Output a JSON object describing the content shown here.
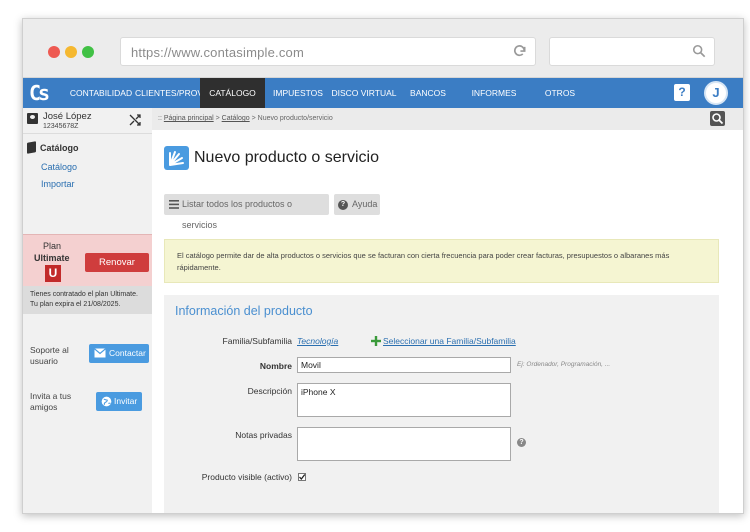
{
  "browser": {
    "url": "https://www.contasimple.com"
  },
  "nav": {
    "logo": "Cs",
    "items": [
      "CONTABILIDAD",
      "CLIENTES/PROV.",
      "CATÁLOGO",
      "IMPUESTOS",
      "DISCO VIRTUAL",
      "BANCOS",
      "INFORMES",
      "OTROS"
    ],
    "active": "CATÁLOGO",
    "help_label": "?",
    "avatar_letter": "J"
  },
  "user": {
    "name": "José López",
    "id": "12345678Z"
  },
  "sidebar": {
    "section_title": "Catálogo",
    "links": [
      "Catálogo",
      "Importar"
    ],
    "plan_label": "Plan",
    "plan_name": "Ultimate",
    "plan_badge": "U",
    "renew_label": "Renovar",
    "plan_info_line1": "Tienes contratado el plan Ultimate.",
    "plan_info_line2": "Tu plan expira el 21/08/2025.",
    "support_line1": "Soporte al",
    "support_line2": "usuario",
    "contact_label": "Contactar",
    "invite_line1": "Invita a tus",
    "invite_line2": "amigos",
    "invite_label": "Invitar"
  },
  "breadcrumb": {
    "prefix": ":: ",
    "home": "Página principal",
    "sep": " > ",
    "catalog": "Catálogo",
    "current": "Nuevo producto/servicio"
  },
  "page": {
    "title": "Nuevo producto o servicio",
    "list_button": "Listar todos los productos o servicios",
    "help_button": "Ayuda",
    "note": "El catálogo permite dar de alta productos o servicios que se facturan con cierta frecuencia para poder crear facturas, presupuestos o albaranes más rápidamente."
  },
  "form": {
    "section_title": "Información del producto",
    "family_label": "Familia/Subfamilia",
    "family_value": "Tecnología",
    "select_family_link": "Seleccionar una Familia/Subfamilia",
    "name_label": "Nombre",
    "name_value": "Movil",
    "name_hint": "Ej: Ordenador, Programación, ...",
    "description_label": "Descripción",
    "description_value": "iPhone X",
    "notes_label": "Notas privadas",
    "notes_value": "",
    "visible_label": "Producto visible (activo)",
    "visible_checked": true
  },
  "colors": {
    "brand_blue": "#3b7dc4",
    "renew_red": "#cf3d3d",
    "note_bg": "#f5f5d2"
  }
}
